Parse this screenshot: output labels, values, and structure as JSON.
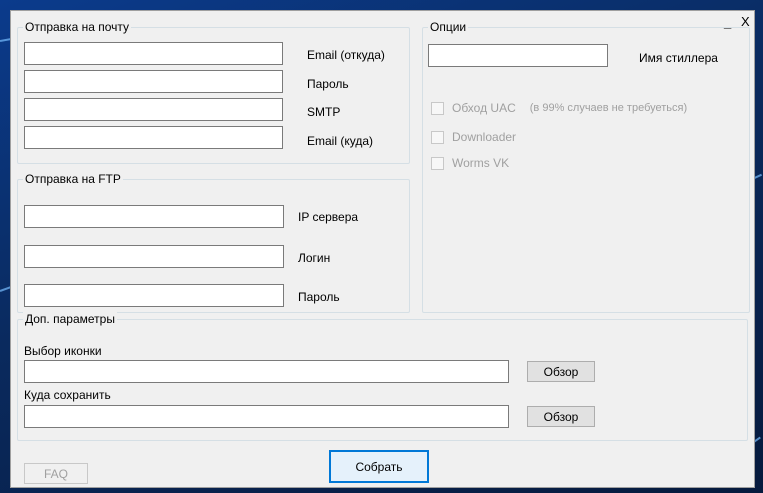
{
  "window_controls": {
    "minimize": "_",
    "close": "X"
  },
  "email_group": {
    "title": "Отправка на почту",
    "fields": [
      {
        "label": "Email (откуда)",
        "value": ""
      },
      {
        "label": "Пароль",
        "value": ""
      },
      {
        "label": "SMTP",
        "value": ""
      },
      {
        "label": "Email (куда)",
        "value": ""
      }
    ]
  },
  "ftp_group": {
    "title": "Отправка на FTP",
    "fields": [
      {
        "label": "IP сервера",
        "value": ""
      },
      {
        "label": "Логин",
        "value": ""
      },
      {
        "label": "Пароль",
        "value": ""
      }
    ]
  },
  "options_group": {
    "title": "Опции",
    "stealer_name_label": "Имя стиллера",
    "stealer_name_value": "",
    "checkboxes": [
      {
        "label": "Обход UAC",
        "note": "(в 99% случаев не требуеться)",
        "checked": false,
        "enabled": false
      },
      {
        "label": "Downloader",
        "checked": false,
        "enabled": false
      },
      {
        "label": "Worms VK",
        "checked": false,
        "enabled": false
      }
    ]
  },
  "extra_group": {
    "title": "Доп. параметры",
    "icon_label": "Выбор иконки",
    "icon_value": "",
    "icon_browse": "Обзор",
    "save_label": "Куда сохранить",
    "save_value": "",
    "save_browse": "Обзор"
  },
  "buttons": {
    "faq": "FAQ",
    "build": "Собрать"
  }
}
